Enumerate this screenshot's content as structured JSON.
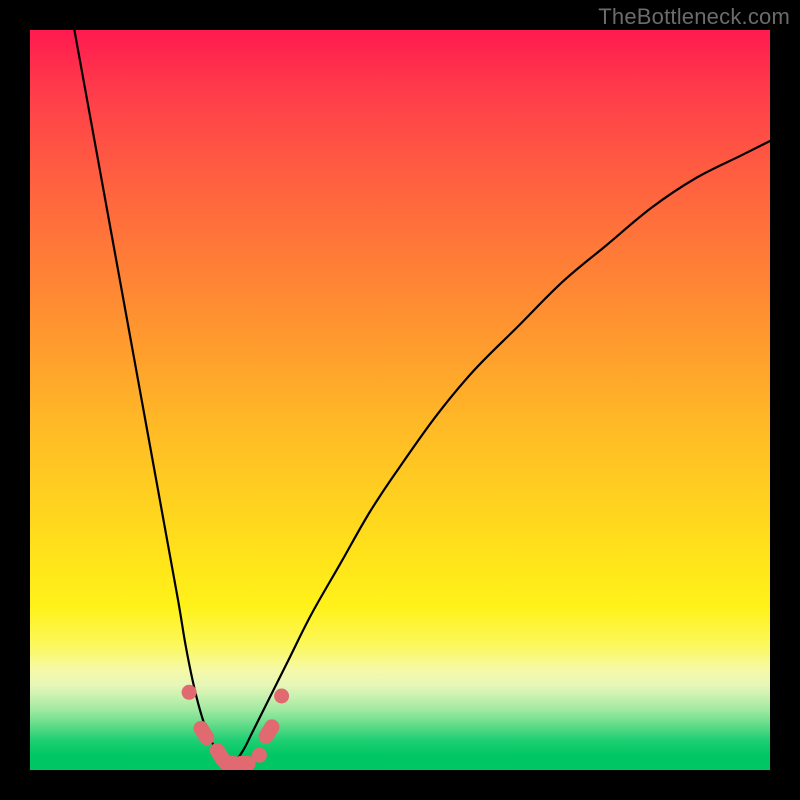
{
  "watermark": "TheBottleneck.com",
  "colors": {
    "frame": "#000000",
    "gradient_top": "#ff1a4f",
    "gradient_bottom": "#00c764",
    "curve": "#000000",
    "marker": "#e06a6f"
  },
  "chart_data": {
    "type": "line",
    "title": "",
    "xlabel": "",
    "ylabel": "",
    "xlim": [
      0,
      100
    ],
    "ylim": [
      0,
      100
    ],
    "grid": false,
    "ticks_x": [],
    "ticks_y": [],
    "note": "Axes are unlabeled in the image; values below are read by position as percentages of the plot area (0 = left/bottom, 100 = right/top).",
    "minimum_x": 27,
    "series": [
      {
        "name": "left-branch",
        "x": [
          6,
          8,
          10,
          12,
          14,
          16,
          18,
          20,
          21,
          22,
          23,
          24,
          25,
          26,
          27
        ],
        "y": [
          100,
          89,
          78,
          67,
          56,
          45,
          34,
          23,
          17,
          12,
          8,
          5,
          3,
          1.5,
          0.8
        ]
      },
      {
        "name": "right-branch",
        "x": [
          27,
          28,
          29,
          30,
          32,
          35,
          38,
          42,
          46,
          50,
          55,
          60,
          66,
          72,
          78,
          84,
          90,
          96,
          100
        ],
        "y": [
          0.8,
          1.5,
          3,
          5,
          9,
          15,
          21,
          28,
          35,
          41,
          48,
          54,
          60,
          66,
          71,
          76,
          80,
          83,
          85
        ]
      }
    ],
    "markers": {
      "name": "pill-markers",
      "note": "Clustered salmon pill-shaped markers near the curve minimum.",
      "points": [
        {
          "x": 21.5,
          "y": 10.5,
          "shape": "circle"
        },
        {
          "x": 23.5,
          "y": 5.0,
          "shape": "pill-diag"
        },
        {
          "x": 25.7,
          "y": 2.0,
          "shape": "pill-diag"
        },
        {
          "x": 27.0,
          "y": 0.9,
          "shape": "pill-h"
        },
        {
          "x": 29.0,
          "y": 0.9,
          "shape": "pill-h"
        },
        {
          "x": 31.0,
          "y": 2.0,
          "shape": "circle"
        },
        {
          "x": 32.3,
          "y": 5.2,
          "shape": "pill-diag-rev"
        },
        {
          "x": 34.0,
          "y": 10.0,
          "shape": "circle"
        }
      ]
    }
  }
}
